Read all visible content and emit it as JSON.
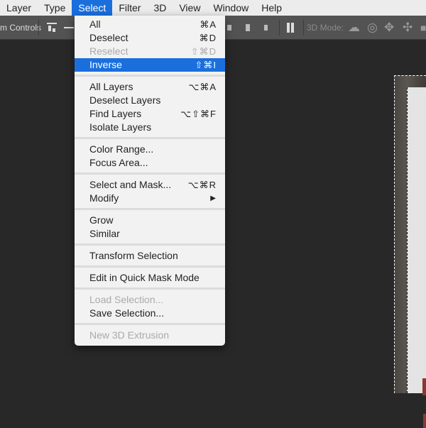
{
  "menubar": {
    "items": [
      "Layer",
      "Type",
      "Select",
      "Filter",
      "3D",
      "View",
      "Window",
      "Help"
    ],
    "active": "Select"
  },
  "toolbar": {
    "transform_controls_label": "m Controls",
    "mode_label": "3D Mode:"
  },
  "menu": {
    "items": [
      {
        "label": "All",
        "shortcut": "⌘A",
        "enabled": true
      },
      {
        "label": "Deselect",
        "shortcut": "⌘D",
        "enabled": true
      },
      {
        "label": "Reselect",
        "shortcut": "⇧⌘D",
        "enabled": false
      },
      {
        "label": "Inverse",
        "shortcut": "⇧⌘I",
        "enabled": true,
        "highlighted": true
      },
      {
        "sep": true
      },
      {
        "label": "All Layers",
        "shortcut": "⌥⌘A",
        "enabled": true
      },
      {
        "label": "Deselect Layers",
        "shortcut": "",
        "enabled": true
      },
      {
        "label": "Find Layers",
        "shortcut": "⌥⇧⌘F",
        "enabled": true
      },
      {
        "label": "Isolate Layers",
        "shortcut": "",
        "enabled": true
      },
      {
        "sep": true
      },
      {
        "label": "Color Range...",
        "shortcut": "",
        "enabled": true
      },
      {
        "label": "Focus Area...",
        "shortcut": "",
        "enabled": true
      },
      {
        "sep": true
      },
      {
        "label": "Select and Mask...",
        "shortcut": "⌥⌘R",
        "enabled": true
      },
      {
        "label": "Modify",
        "shortcut": "▶",
        "enabled": true,
        "submenu": true
      },
      {
        "sep": true
      },
      {
        "label": "Grow",
        "shortcut": "",
        "enabled": true
      },
      {
        "label": "Similar",
        "shortcut": "",
        "enabled": true
      },
      {
        "sep": true
      },
      {
        "label": "Transform Selection",
        "shortcut": "",
        "enabled": true
      },
      {
        "sep": true
      },
      {
        "label": "Edit in Quick Mask Mode",
        "shortcut": "",
        "enabled": true
      },
      {
        "sep": true
      },
      {
        "label": "Load Selection...",
        "shortcut": "",
        "enabled": false
      },
      {
        "label": "Save Selection...",
        "shortcut": "",
        "enabled": true
      },
      {
        "sep": true
      },
      {
        "label": "New 3D Extrusion",
        "shortcut": "",
        "enabled": false
      }
    ]
  },
  "colors": {
    "highlight": "#1a6fdd",
    "toolbar": "#535353",
    "canvas": "#282828"
  }
}
